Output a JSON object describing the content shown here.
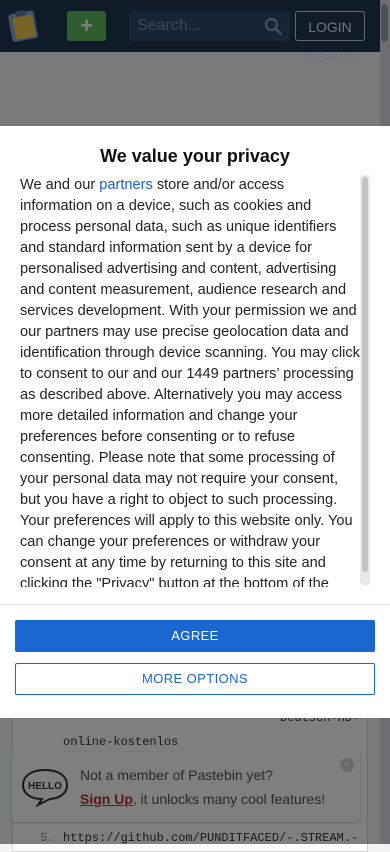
{
  "header": {
    "add_label": "+",
    "search_placeholder": "Search...",
    "login_label": "LOGIN",
    "signup_label": "SIGN UP"
  },
  "background": {
    "code_fragments": [
      "Deutsch-HD-",
      "online-kostenlos",
      "https://github.com/PUNDITFACED/-.STREAM.-"
    ],
    "line_number": "5.",
    "notice": {
      "text": "Not a member of Pastebin yet?",
      "signup_link": "Sign Up",
      "rest": ", it unlocks many cool features!"
    }
  },
  "consent": {
    "title": "We value your privacy",
    "body_before_link": "We and our ",
    "link_text": "partners",
    "body_after_link": " store and/or access information on a device, such as cookies and process personal data, such as unique identifiers and standard information sent by a device for personalised advertising and content, advertising and content measurement, audience research and services development. With your permission we and our partners may use precise geolocation data and identification through device scanning. You may click to consent to our and our 1449 partners’ processing as described above. Alternatively you may access more detailed information and change your preferences before consenting or to refuse consenting. Please note that some processing of your personal data may not require your consent, but you have a right to object to such processing. Your preferences will apply to this website only. You can change your preferences or withdraw your consent at any time by returning to this site and clicking the \"Privacy\" button at the bottom of the webpage.",
    "agree_label": "AGREE",
    "more_label": "MORE OPTIONS"
  },
  "colors": {
    "header": "#1f3650",
    "primary": "#1a67d2",
    "add": "#5cb85c"
  }
}
